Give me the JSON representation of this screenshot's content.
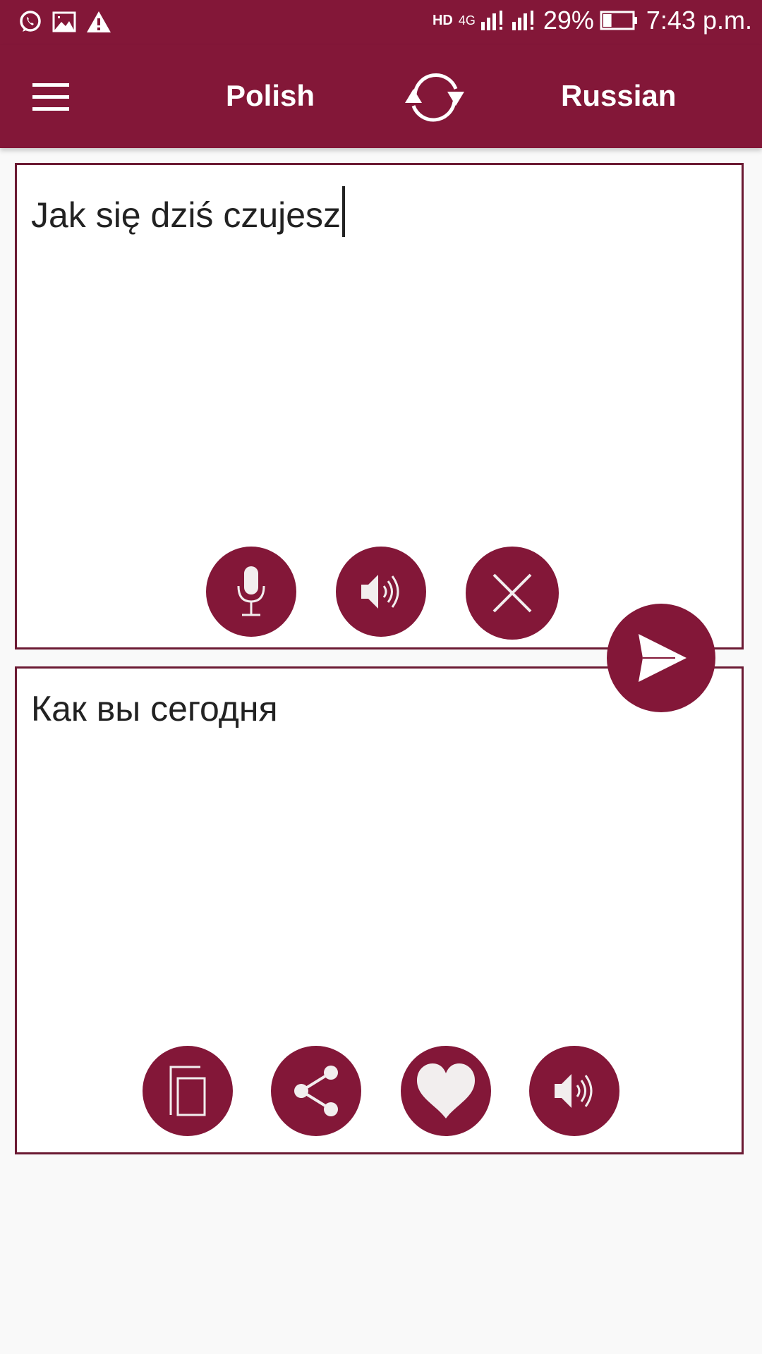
{
  "status_bar": {
    "left_icons": [
      "whatsapp-icon",
      "image-icon",
      "warning-icon"
    ],
    "hd_label": "HD",
    "network_label": "4G",
    "battery_percent": "29%",
    "battery_level": 0.29,
    "time": "7:43 p.m."
  },
  "toolbar": {
    "menu_icon": "hamburger-icon",
    "source_language": "Polish",
    "swap_icon": "swap-icon",
    "target_language": "Russian"
  },
  "input": {
    "value": "Jak się dziś czujesz",
    "actions": [
      {
        "name": "microphone",
        "icon": "microphone-icon"
      },
      {
        "name": "speak",
        "icon": "speaker-icon"
      },
      {
        "name": "clear",
        "icon": "close-icon"
      }
    ]
  },
  "translate_button": {
    "icon": "send-icon"
  },
  "output": {
    "value": "Как вы сегодня",
    "actions": [
      {
        "name": "copy",
        "icon": "copy-icon"
      },
      {
        "name": "share",
        "icon": "share-icon"
      },
      {
        "name": "favorite",
        "icon": "heart-icon"
      },
      {
        "name": "speak",
        "icon": "speaker-icon"
      }
    ]
  },
  "colors": {
    "primary": "#831738",
    "border": "#6b1a33",
    "background": "#f9f9f9"
  }
}
